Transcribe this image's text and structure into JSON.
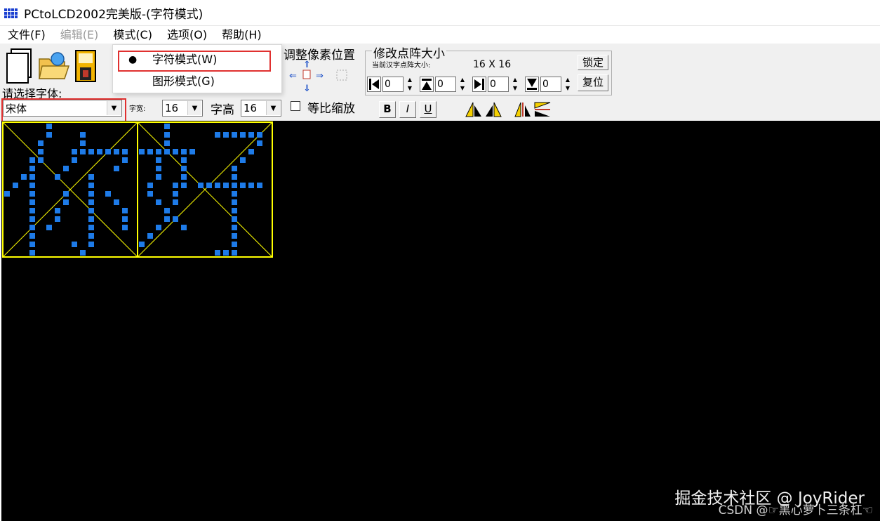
{
  "window": {
    "title": "PCtoLCD2002完美版-(字符模式)"
  },
  "menubar": {
    "items": [
      {
        "label": "文件(F)",
        "enabled": true
      },
      {
        "label": "编辑(E)",
        "enabled": false
      },
      {
        "label": "模式(C)",
        "enabled": true
      },
      {
        "label": "选项(O)",
        "enabled": true
      },
      {
        "label": "帮助(H)",
        "enabled": true
      }
    ]
  },
  "mode_menu": {
    "items": [
      {
        "label": "字符模式(W)",
        "checked": true,
        "bullet": "●"
      },
      {
        "label": "图形模式(G)",
        "checked": false,
        "bullet": ""
      }
    ]
  },
  "toolbar": {
    "font_prompt": "请选择字体:",
    "font_value": "宋体",
    "char_width_label": "字宽:",
    "char_width_value": "16",
    "char_height_label": "字高",
    "char_height_value": "16",
    "proportional_label": "等比缩放",
    "proportional_checked": false,
    "bold_label": "B",
    "italic_label": "I",
    "underline_label": "U",
    "adjust_pixel_label": "调整像素位置",
    "matrix_group_label": "修改点阵大小",
    "current_size_label": "当前汉字点阵大小:",
    "current_size_value": "16  X  16",
    "lock_label": "锁定",
    "reset_label": "复位",
    "spinners": [
      "0",
      "0",
      "0",
      "0"
    ]
  },
  "canvas": {
    "background": "#000000",
    "pixel_color": "#1e7be8",
    "frame_color": "#ffff00",
    "characters": [
      "你",
      "好"
    ]
  },
  "watermark": {
    "line1": "掘金技术社区 @ JoyRider",
    "line2": "CSDN @☞黑心萝卜三条杠☜"
  }
}
